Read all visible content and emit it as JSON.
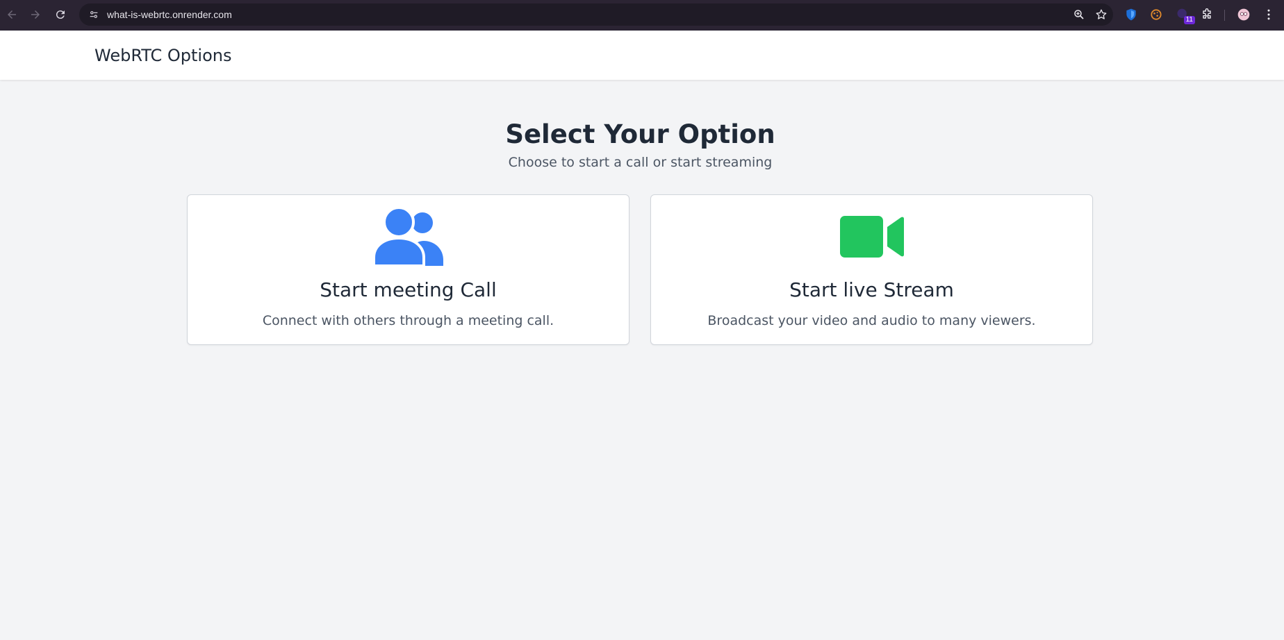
{
  "browser": {
    "url": "what-is-webrtc.onrender.com",
    "extension_badge": "11"
  },
  "header": {
    "brand": "WebRTC Options"
  },
  "main": {
    "title": "Select Your Option",
    "subtitle": "Choose to start a call or start streaming",
    "options": [
      {
        "title": "Start meeting Call",
        "description": "Connect with others through a meeting call.",
        "icon": "users-icon",
        "color": "#3b82f6"
      },
      {
        "title": "Start live Stream",
        "description": "Broadcast your video and audio to many viewers.",
        "icon": "video-camera-icon",
        "color": "#22c55e"
      }
    ]
  }
}
